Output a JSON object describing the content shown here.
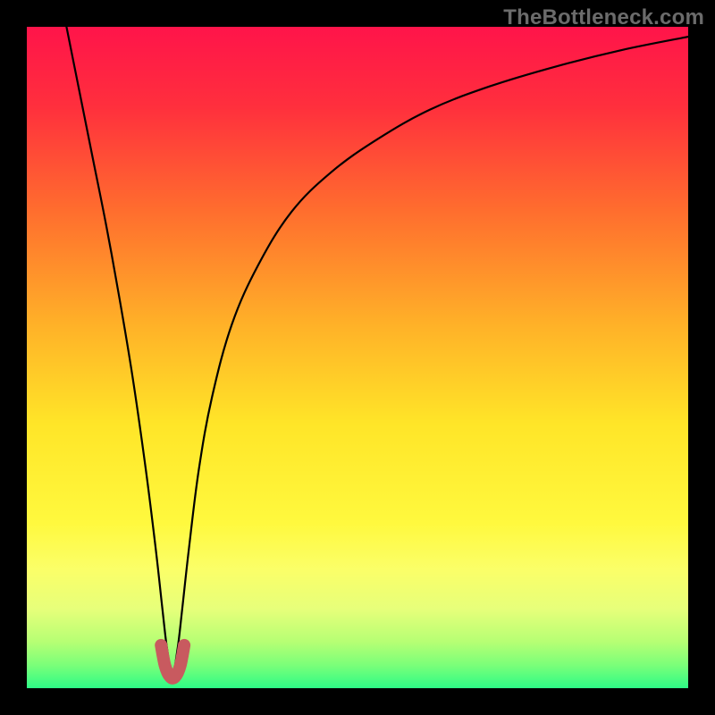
{
  "watermark": "TheBottleneck.com",
  "chart_data": {
    "type": "line",
    "title": "",
    "xlabel": "",
    "ylabel": "",
    "xlim": [
      0,
      100
    ],
    "ylim": [
      0,
      100
    ],
    "optimum_x": 22,
    "gradient_stops": [
      {
        "offset": 0,
        "color": "#ff144a"
      },
      {
        "offset": 0.12,
        "color": "#ff2f3d"
      },
      {
        "offset": 0.28,
        "color": "#ff6e2e"
      },
      {
        "offset": 0.45,
        "color": "#ffb128"
      },
      {
        "offset": 0.6,
        "color": "#ffe528"
      },
      {
        "offset": 0.75,
        "color": "#fff93e"
      },
      {
        "offset": 0.82,
        "color": "#fbff68"
      },
      {
        "offset": 0.88,
        "color": "#e7ff7a"
      },
      {
        "offset": 0.93,
        "color": "#b6ff74"
      },
      {
        "offset": 0.965,
        "color": "#7bff79"
      },
      {
        "offset": 1.0,
        "color": "#2dfb86"
      }
    ],
    "series": [
      {
        "name": "bottleneck-curve",
        "x": [
          6,
          8,
          10,
          12,
          14,
          16,
          18,
          19.5,
          20.5,
          21.2,
          22,
          22.8,
          23.5,
          24.5,
          26,
          28,
          31,
          35,
          40,
          46,
          53,
          61,
          70,
          80,
          90,
          100
        ],
        "values": [
          100,
          90,
          80,
          70,
          59,
          47,
          33,
          21,
          12,
          6,
          2,
          6,
          12,
          21,
          33,
          44,
          55,
          64,
          72,
          78,
          83,
          87.5,
          91,
          94,
          96.5,
          98.5
        ]
      },
      {
        "name": "sweet-spot-marker",
        "x": [
          20.3,
          20.6,
          20.9,
          21.3,
          21.7,
          22.0,
          22.4,
          22.8,
          23.2,
          23.5,
          23.8
        ],
        "values": [
          6.5,
          4.8,
          3.4,
          2.3,
          1.7,
          1.5,
          1.7,
          2.3,
          3.4,
          4.8,
          6.5
        ]
      }
    ]
  }
}
